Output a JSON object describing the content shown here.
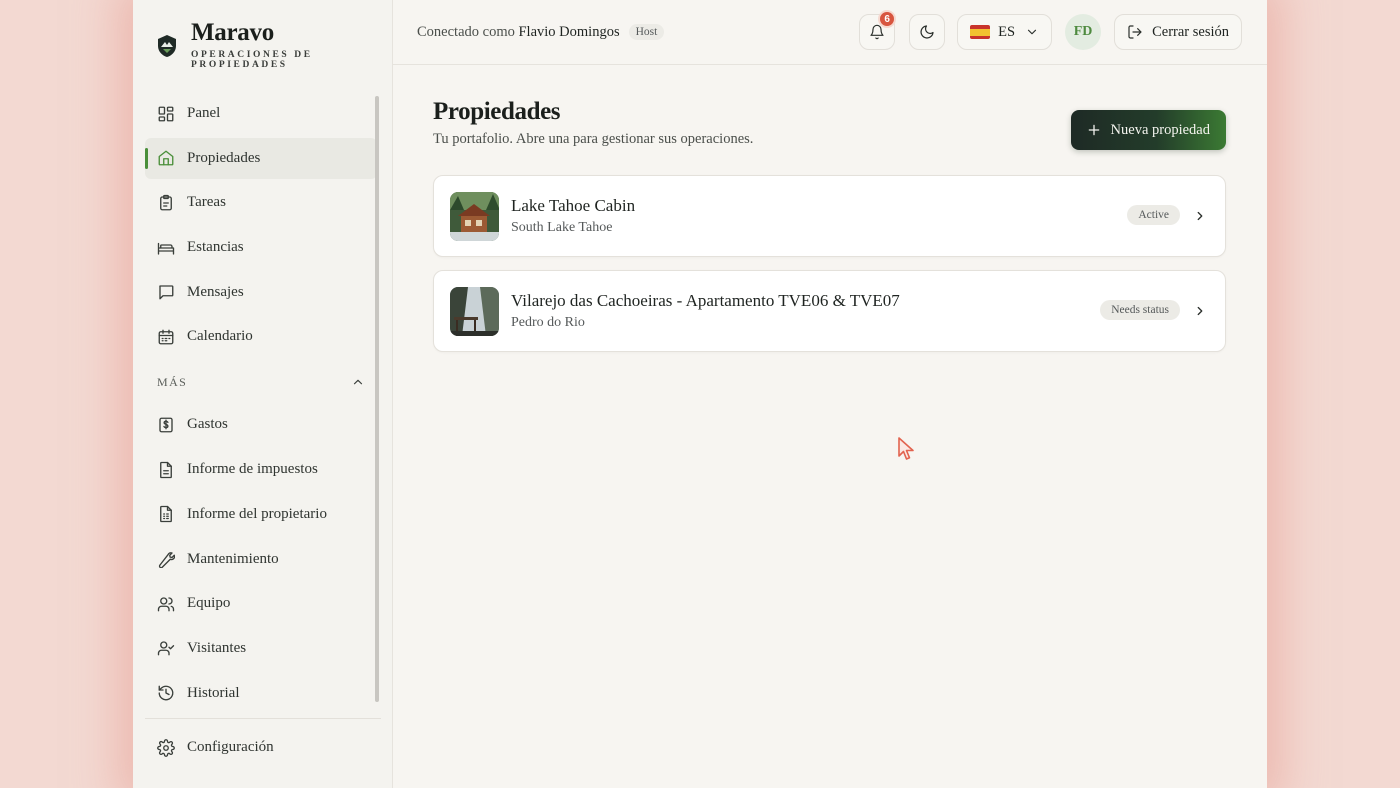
{
  "brand": {
    "name": "Maravo",
    "subtitle": "OPERACIONES DE PROPIEDADES"
  },
  "sidebar": {
    "items": [
      {
        "label": "Panel",
        "icon": "dashboard-icon",
        "active": false
      },
      {
        "label": "Propiedades",
        "icon": "home-icon",
        "active": true
      },
      {
        "label": "Tareas",
        "icon": "clipboard-icon",
        "active": false
      },
      {
        "label": "Estancias",
        "icon": "bed-icon",
        "active": false
      },
      {
        "label": "Mensajes",
        "icon": "message-icon",
        "active": false
      },
      {
        "label": "Calendario",
        "icon": "calendar-icon",
        "active": false
      }
    ],
    "section_label": "MÁS",
    "more_items": [
      {
        "label": "Gastos",
        "icon": "dollar-icon"
      },
      {
        "label": "Informe de impuestos",
        "icon": "document-icon"
      },
      {
        "label": "Informe del propietario",
        "icon": "report-icon"
      },
      {
        "label": "Mantenimiento",
        "icon": "wrench-icon"
      },
      {
        "label": "Equipo",
        "icon": "users-icon"
      },
      {
        "label": "Visitantes",
        "icon": "user-check-icon"
      },
      {
        "label": "Historial",
        "icon": "history-icon"
      }
    ],
    "footer_item": {
      "label": "Configuración",
      "icon": "gear-icon"
    }
  },
  "topbar": {
    "connected_prefix": "Conectado como",
    "user_name": "Flavio Domingos",
    "role": "Host",
    "notifications_count": "6",
    "language": "ES",
    "avatar_initials": "FD",
    "logout_label": "Cerrar sesión"
  },
  "page": {
    "title": "Propiedades",
    "subtitle": "Tu portafolio. Abre una para gestionar sus operaciones.",
    "new_button_label": "Nueva propiedad"
  },
  "properties": [
    {
      "name": "Lake Tahoe Cabin",
      "location": "South Lake Tahoe",
      "status": "Active"
    },
    {
      "name": "Vilarejo das Cachoeiras - Apartamento TVE06 & TVE07",
      "location": "Pedro do Rio",
      "status": "Needs status"
    }
  ],
  "colors": {
    "accent_green": "#4a8f3a",
    "notification_red": "#d8553f",
    "primary_button_dark": "#1e2a25"
  }
}
